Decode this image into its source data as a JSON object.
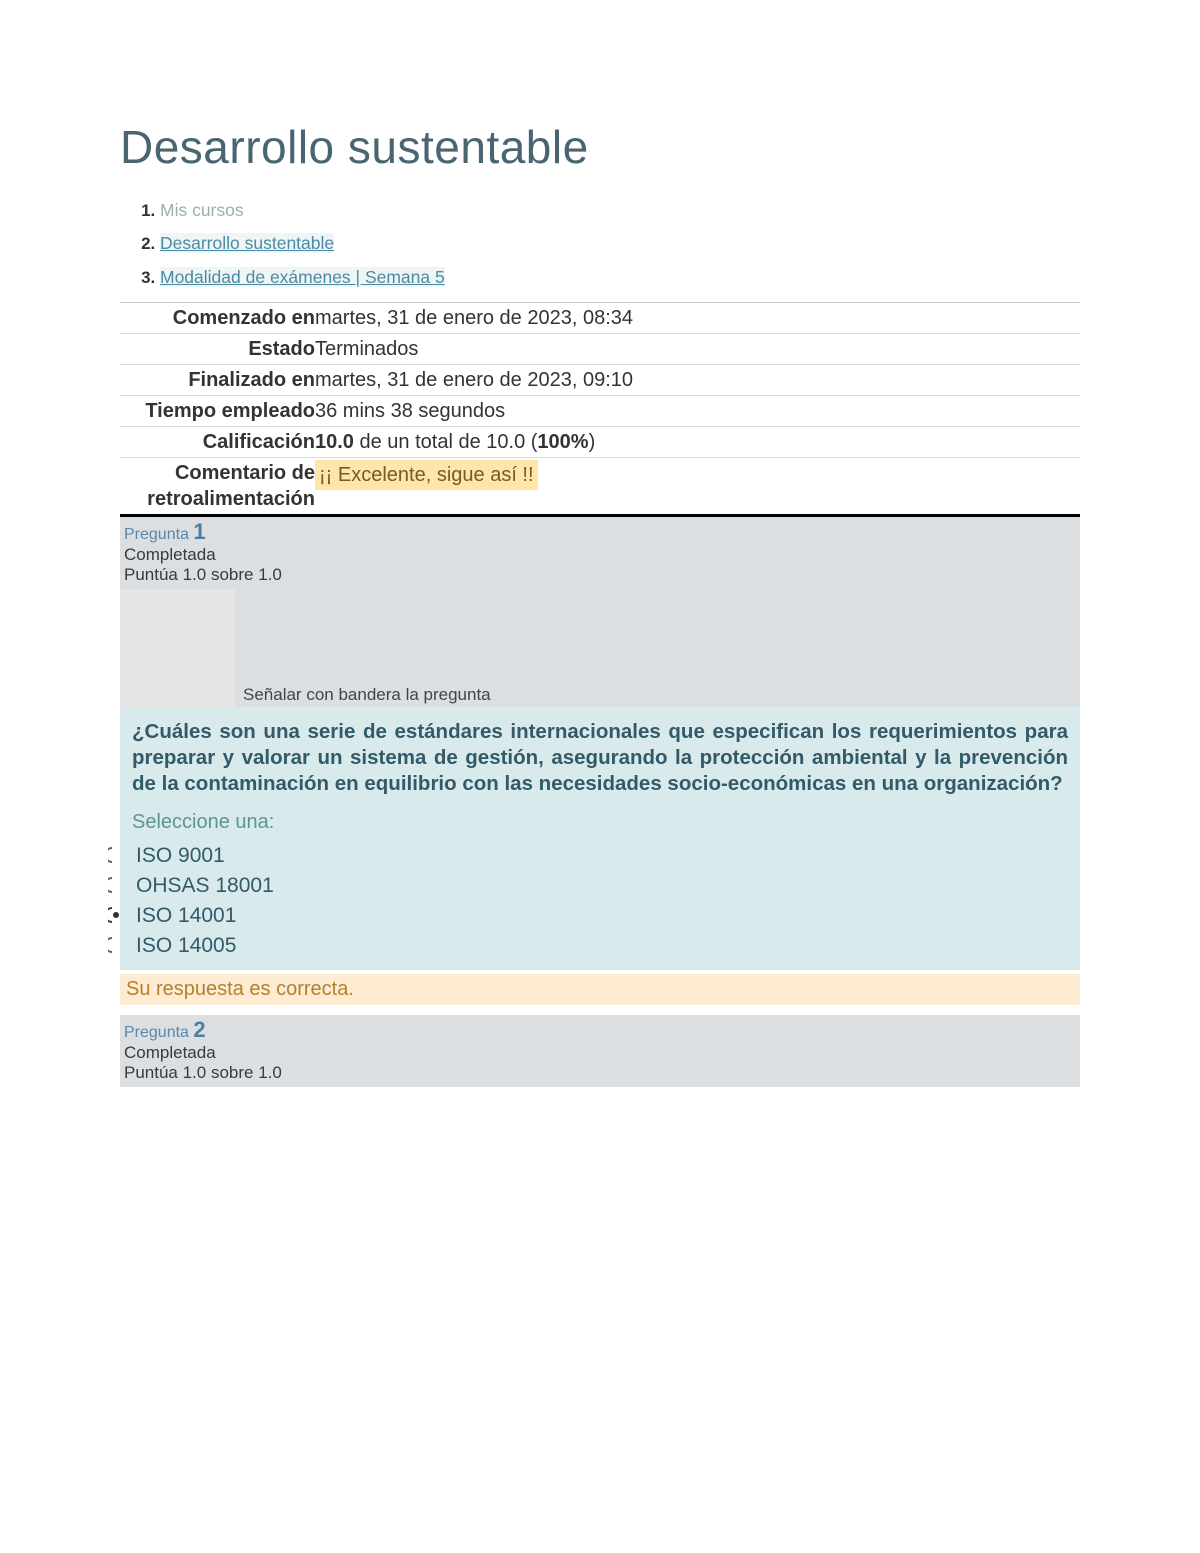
{
  "title": "Desarrollo sustentable",
  "breadcrumb": [
    {
      "text": "Mis cursos",
      "muted": true
    },
    {
      "text": "Desarrollo sustentable",
      "muted": false
    },
    {
      "text": "Modalidad de exámenes | Semana 5",
      "muted": false
    }
  ],
  "summary": {
    "started_label": "Comenzado en",
    "started_value": "martes, 31 de enero de 2023, 08:34",
    "state_label": "Estado",
    "state_value": "Terminados",
    "finished_label": "Finalizado en",
    "finished_value": "martes, 31 de enero de 2023, 09:10",
    "time_label": "Tiempo empleado",
    "time_value": "36 mins 38 segundos",
    "grade_label": "Calificación",
    "grade_score": "10.0",
    "grade_mid": " de un total de 10.0 (",
    "grade_percent": "100%",
    "grade_tail": ")",
    "feedback_label": "Comentario de retroalimentación",
    "feedback_value": "¡¡ Excelente, sigue así !!"
  },
  "question1": {
    "num_label": "Pregunta ",
    "num": "1",
    "status": "Completada",
    "points": "Puntúa 1.0 sobre 1.0",
    "flag_text": "Señalar con bandera la pregunta",
    "text": "¿Cuáles son una serie de estándares internacionales que especifican los requerimientos para preparar y valorar un sistema de gestión, asegurando la protección ambiental y la prevención de la contaminación en equilibrio con las necesidades socio-económicas en una organización?",
    "select_one": "Seleccione una:",
    "options": [
      {
        "label": "ISO 9001",
        "selected": false
      },
      {
        "label": "OHSAS 18001",
        "selected": false
      },
      {
        "label": "ISO 14001",
        "selected": true
      },
      {
        "label": "ISO 14005",
        "selected": false
      }
    ],
    "answer_feedback": "Su respuesta es correcta."
  },
  "question2": {
    "num_label": "Pregunta ",
    "num": "2",
    "status": "Completada",
    "points": "Puntúa 1.0 sobre 1.0"
  }
}
